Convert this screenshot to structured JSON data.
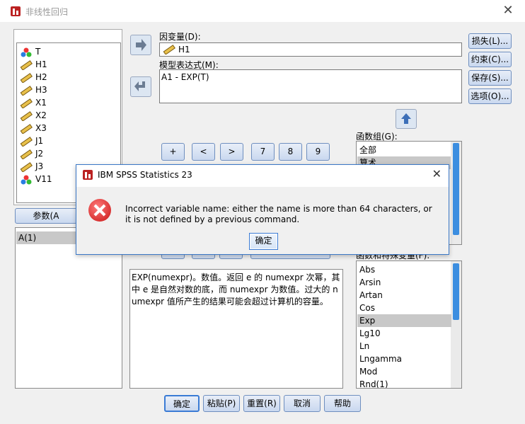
{
  "window": {
    "title": "非线性回归",
    "close": "✕"
  },
  "variables": [
    "T",
    "H1",
    "H2",
    "H3",
    "X1",
    "X2",
    "X3",
    "J1",
    "J2",
    "J3",
    "V11"
  ],
  "params_button": "参数(A",
  "params_list": [
    "A(1)"
  ],
  "dependent": {
    "label": "因变量(D):",
    "value": "H1"
  },
  "model": {
    "label": "模型表达式(M):",
    "value": "A1 - EXP(T)"
  },
  "side_buttons": [
    "损失(L)...",
    "约束(C)...",
    "保存(S)...",
    "选项(O)..."
  ],
  "keypad_row1": [
    "+",
    "<",
    ">",
    "7",
    "8",
    "9"
  ],
  "function_group": {
    "label": "函数组(G):",
    "items": [
      "全部",
      "算术"
    ]
  },
  "func_vars": {
    "label": "函数和特殊变量(F):",
    "items": [
      "Abs",
      "Arsin",
      "Artan",
      "Cos",
      "Exp",
      "Lg10",
      "Ln",
      "Lngamma",
      "Mod",
      "Rnd(1)"
    ],
    "selected": "Exp"
  },
  "description": "EXP(numexpr)。数值。返回 e 的 numexpr 次幂，其中 e 是自然对数的底，而 numexpr 为数值。过大的 numexpr 值所产生的结果可能会超过计算机的容量。",
  "bottom_buttons": [
    "确定",
    "粘贴(P)",
    "重置(R)",
    "取消",
    "帮助"
  ],
  "dialog": {
    "title": "IBM SPSS Statistics 23",
    "close": "✕",
    "message": "Incorrect variable name: either the name is more than 64 characters, or it is not defined by a previous command.",
    "ok": "确定"
  },
  "icons": {
    "app": "spss-app-icon",
    "error": "error-icon",
    "ruler": "scale-variable-icon",
    "nominal": "nominal-variable-icon"
  },
  "colors": {
    "accent": "#3c8ee0",
    "dialog_border": "#3b78c7",
    "error": "#c81414"
  }
}
